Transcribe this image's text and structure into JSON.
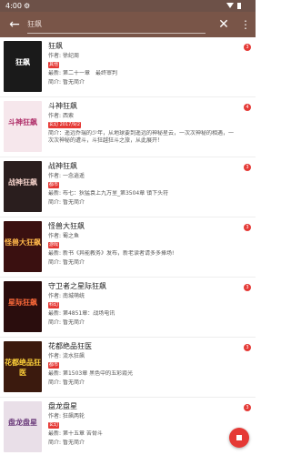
{
  "status_bar": {
    "time": "4:00",
    "settings_glyph": "⚙"
  },
  "toolbar": {
    "back_glyph": "←",
    "search_value": "狂飙",
    "clear_glyph": "✕",
    "more_glyph": "⋮",
    "colors": {
      "status": "#6d5148",
      "toolbar": "#795548"
    }
  },
  "labels": {
    "author": "作者:",
    "latest": "最新:",
    "intro": "简介:"
  },
  "books": [
    {
      "title": "狂飙",
      "author": "徐纪周",
      "tag": "其他",
      "tag_color": "#e53935",
      "latest": "第二十一章　最终审判",
      "intro": "暂无简介",
      "badge": "3",
      "cover_text": "狂飙",
      "cover_bg": "#1a1a1a",
      "cover_fg": "#ffffff"
    },
    {
      "title": "斗神狂飙",
      "author": "西索",
      "tag": "玄幻",
      "tag_color": "#e53935",
      "tag_extra": " 2017/9/2",
      "latest": "",
      "intro": "简介：遥远乔瑞的少年，从地球要到遥远的神秘星云，一次次神秘的相遇，一次次神秘的遭斗，斗狂越狂斗之旅，从此展开！",
      "badge": "4",
      "cover_text": "斗神狂飙",
      "cover_bg": "#f6e7ec",
      "cover_fg": "#b0306a"
    },
    {
      "title": "战神狂飙",
      "author": "一念逍遥",
      "tag": "都市",
      "tag_color": "#e53935",
      "latest": "布七：狄猛袁上九万里_第3504章 镇下头符",
      "intro": "暂无简介",
      "badge": "3",
      "cover_text": "战神狂飙",
      "cover_bg": "#2a1e1e",
      "cover_fg": "#f2d0c8"
    },
    {
      "title": "怪兽大狂飙",
      "author": "蜀之鱼",
      "tag": "游戏",
      "tag_color": "#e53935",
      "latest": "新书《异能教务》发布，新老读者请多多捧场!",
      "intro": "暂无简介",
      "badge": "3",
      "cover_text": "怪兽大狂飙",
      "cover_bg": "#3a1010",
      "cover_fg": "#ffb84a"
    },
    {
      "title": "守卫者之星际狂飙",
      "author": "南城萌统",
      "tag": "科幻",
      "tag_color": "#e53935",
      "latest": "第4851章：战场电讯",
      "intro": "暂无简介",
      "badge": "3",
      "cover_text": "星际狂飙",
      "cover_bg": "#2a0d0d",
      "cover_fg": "#ff6a3a"
    },
    {
      "title": "花都绝品狂医",
      "author": "流水狂飙",
      "tag": "都市",
      "tag_color": "#e53935",
      "latest": "第1503章 黑色中的五彩霞光",
      "intro": "暂无简介",
      "badge": "3",
      "cover_text": "花都绝品狂医",
      "cover_bg": "#3b1a0e",
      "cover_fg": "#ffd23a"
    },
    {
      "title": "盘龙盘星",
      "author": "狂飙两轮",
      "tag": "玄幻",
      "tag_color": "#e53935",
      "latest": "第十五章 苦骨斗",
      "intro": "暂无简介",
      "badge": "3",
      "cover_text": "盘龙盘星",
      "cover_bg": "#e9dfe8",
      "cover_fg": "#6a3a7a"
    }
  ]
}
